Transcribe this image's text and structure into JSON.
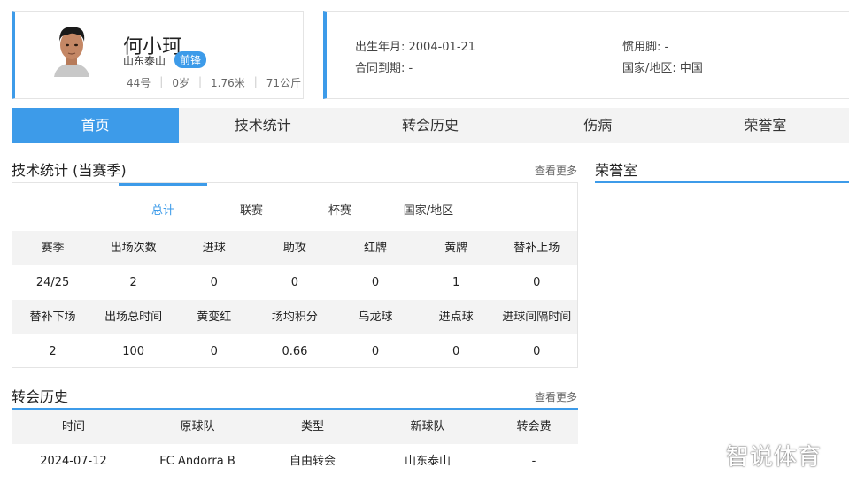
{
  "player": {
    "name": "何小珂",
    "club": "山东泰山",
    "position": "前锋",
    "number": "44号",
    "age": "0岁",
    "height": "1.76米",
    "weight": "71公斤"
  },
  "info": {
    "birth_label": "出生年月: 2004-01-21",
    "foot_label": "惯用脚: -",
    "contract_label": "合同到期: -",
    "nation_label": "国家/地区: 中国"
  },
  "tabs": [
    "首页",
    "技术统计",
    "转会历史",
    "伤病",
    "荣誉室"
  ],
  "stats_section": {
    "title": "技术统计 (当赛季)",
    "more": "查看更多",
    "subtabs": [
      "总计",
      "联赛",
      "杯赛",
      "国家/地区"
    ],
    "header1": [
      "赛季",
      "出场次数",
      "进球",
      "助攻",
      "红牌",
      "黄牌",
      "替补上场"
    ],
    "row1": [
      "24/25",
      "2",
      "0",
      "0",
      "0",
      "1",
      "0"
    ],
    "header2": [
      "替补下场",
      "出场总时间",
      "黄变红",
      "场均积分",
      "乌龙球",
      "进点球",
      "进球间隔时间"
    ],
    "row2": [
      "2",
      "100",
      "0",
      "0.66",
      "0",
      "0",
      "0"
    ]
  },
  "honors_section": {
    "title": "荣誉室"
  },
  "transfer_section": {
    "title": "转会历史",
    "more": "查看更多",
    "header": [
      "时间",
      "原球队",
      "类型",
      "新球队",
      "转会费"
    ],
    "rows": [
      [
        "2024-07-12",
        "FC Andorra B",
        "自由转会",
        "山东泰山",
        "-"
      ]
    ]
  },
  "watermark": "智说体育",
  "colors": {
    "accent": "#3d9be9",
    "header_bg": "#f3f3f3"
  }
}
